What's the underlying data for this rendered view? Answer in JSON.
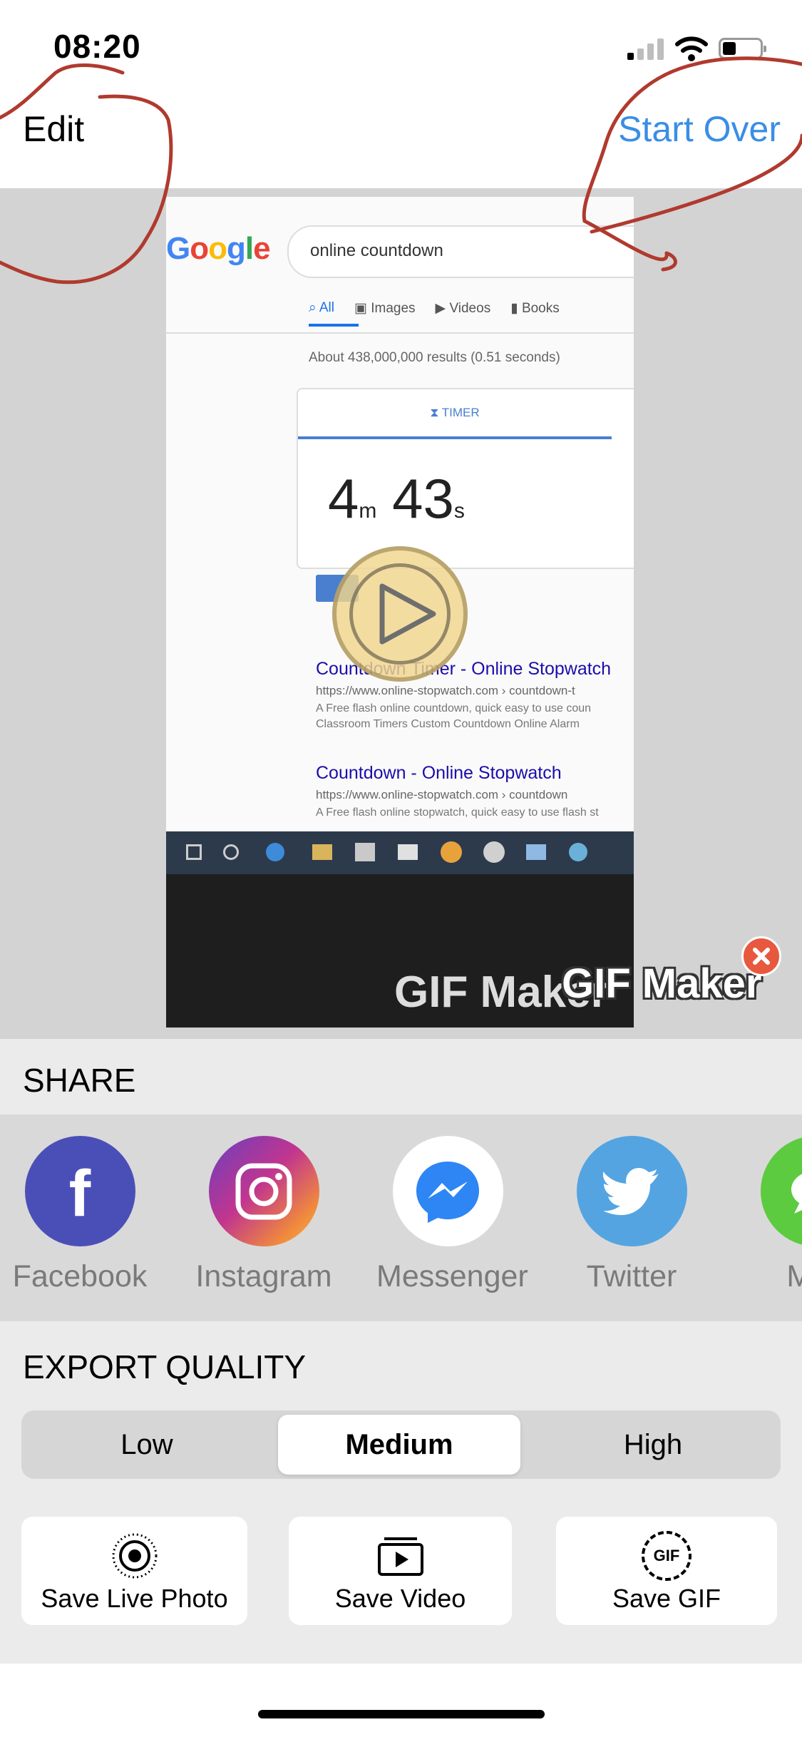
{
  "status_bar": {
    "time": "08:20"
  },
  "nav": {
    "left_label": "Edit",
    "right_label": "Start Over"
  },
  "preview": {
    "search_query": "online countdown",
    "tabs": [
      "All",
      "Images",
      "Videos",
      "Books"
    ],
    "results_count": "About 438,000,000 results (0.51 seconds)",
    "timer_tab": "TIMER",
    "timer_minutes": "4",
    "timer_minutes_unit": "m",
    "timer_seconds": "43",
    "timer_seconds_unit": "s",
    "result1_title": "Countdown Timer - Online Stopwatch",
    "result1_url": "https://www.online-stopwatch.com › countdown-t",
    "result1_snippet": "A Free flash online countdown, quick easy to use coun",
    "result1_links": "Classroom Timers   Custom Countdown   Online Alarm",
    "result2_title": "Countdown - Online Stopwatch",
    "result2_url": "https://www.online-stopwatch.com › countdown",
    "result2_snippet": "A Free flash online stopwatch, quick easy to use flash st",
    "watermark_video": "GIF Maker",
    "watermark_badge": "GIF Maker"
  },
  "share": {
    "title": "SHARE",
    "items": [
      {
        "label": "Facebook",
        "color": "#4a4fb8"
      },
      {
        "label": "Instagram",
        "color": "#c1358f"
      },
      {
        "label": "Messenger",
        "color": "#ffffff"
      },
      {
        "label": "Twitter",
        "color": "#54a4e2"
      },
      {
        "label": "Mes",
        "color": "#5ccb3f"
      }
    ]
  },
  "export": {
    "title": "EXPORT QUALITY",
    "options": [
      "Low",
      "Medium",
      "High"
    ],
    "selected": "Medium"
  },
  "save": {
    "live_photo": "Save Live Photo",
    "video": "Save Video",
    "gif": "Save GIF",
    "gif_icon_text": "GIF"
  },
  "colors": {
    "accent": "#3a8ee6",
    "annotation": "#b03a2e"
  }
}
